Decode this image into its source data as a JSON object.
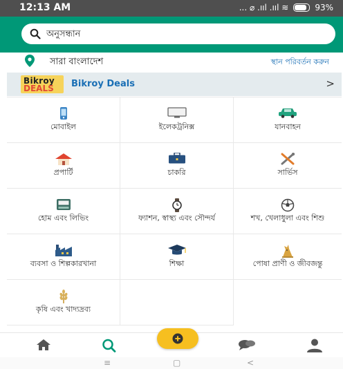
{
  "status_bar": {
    "time": "12:13 AM",
    "signal_text": "... ⌀ .ııl .ııl ≋",
    "battery": "93%"
  },
  "search": {
    "placeholder": "অনুসন্ধান"
  },
  "location": {
    "name": "সারা বাংলাদেশ",
    "change_label": "স্থান পরিবর্তন করুন"
  },
  "deals": {
    "logo_line1": "Bikroy",
    "logo_line2": "DEALS",
    "title": "Bikroy Deals",
    "arrow": ">"
  },
  "categories": [
    {
      "label": "মোবাইল",
      "icon": "mobile-icon"
    },
    {
      "label": "ইলেকট্রনিক্স",
      "icon": "monitor-icon"
    },
    {
      "label": "যানবাহন",
      "icon": "car-icon"
    },
    {
      "label": "প্রপার্টি",
      "icon": "house-icon"
    },
    {
      "label": "চাকরি",
      "icon": "briefcase-icon"
    },
    {
      "label": "সার্ভিস",
      "icon": "tools-icon"
    },
    {
      "label": "হোম এবং লিভিং",
      "icon": "appliance-icon"
    },
    {
      "label": "ফ্যাশন, স্বাস্থ্য এবং সৌন্দর্য",
      "icon": "watch-icon"
    },
    {
      "label": "শখ, খেলাধুলা এবং শিশু",
      "icon": "ball-icon"
    },
    {
      "label": "ব্যবসা ও শিল্পকারখানা",
      "icon": "factory-icon"
    },
    {
      "label": "শিক্ষা",
      "icon": "graduation-cap-icon"
    },
    {
      "label": "পোষা প্রাণী ও জীবজন্তু",
      "icon": "dog-icon"
    },
    {
      "label": "কৃষি এবং খাদ্যদ্রব্য",
      "icon": "wheat-icon"
    }
  ],
  "bottom_nav": {
    "fab_symbol": "+"
  },
  "system_nav": {
    "menu": "≡",
    "home": "▢",
    "back": "<"
  },
  "colors": {
    "header": "#009877",
    "accent_yellow": "#f6bf20",
    "link_blue": "#1a6fb5",
    "deals_bg": "#e4ebee"
  }
}
